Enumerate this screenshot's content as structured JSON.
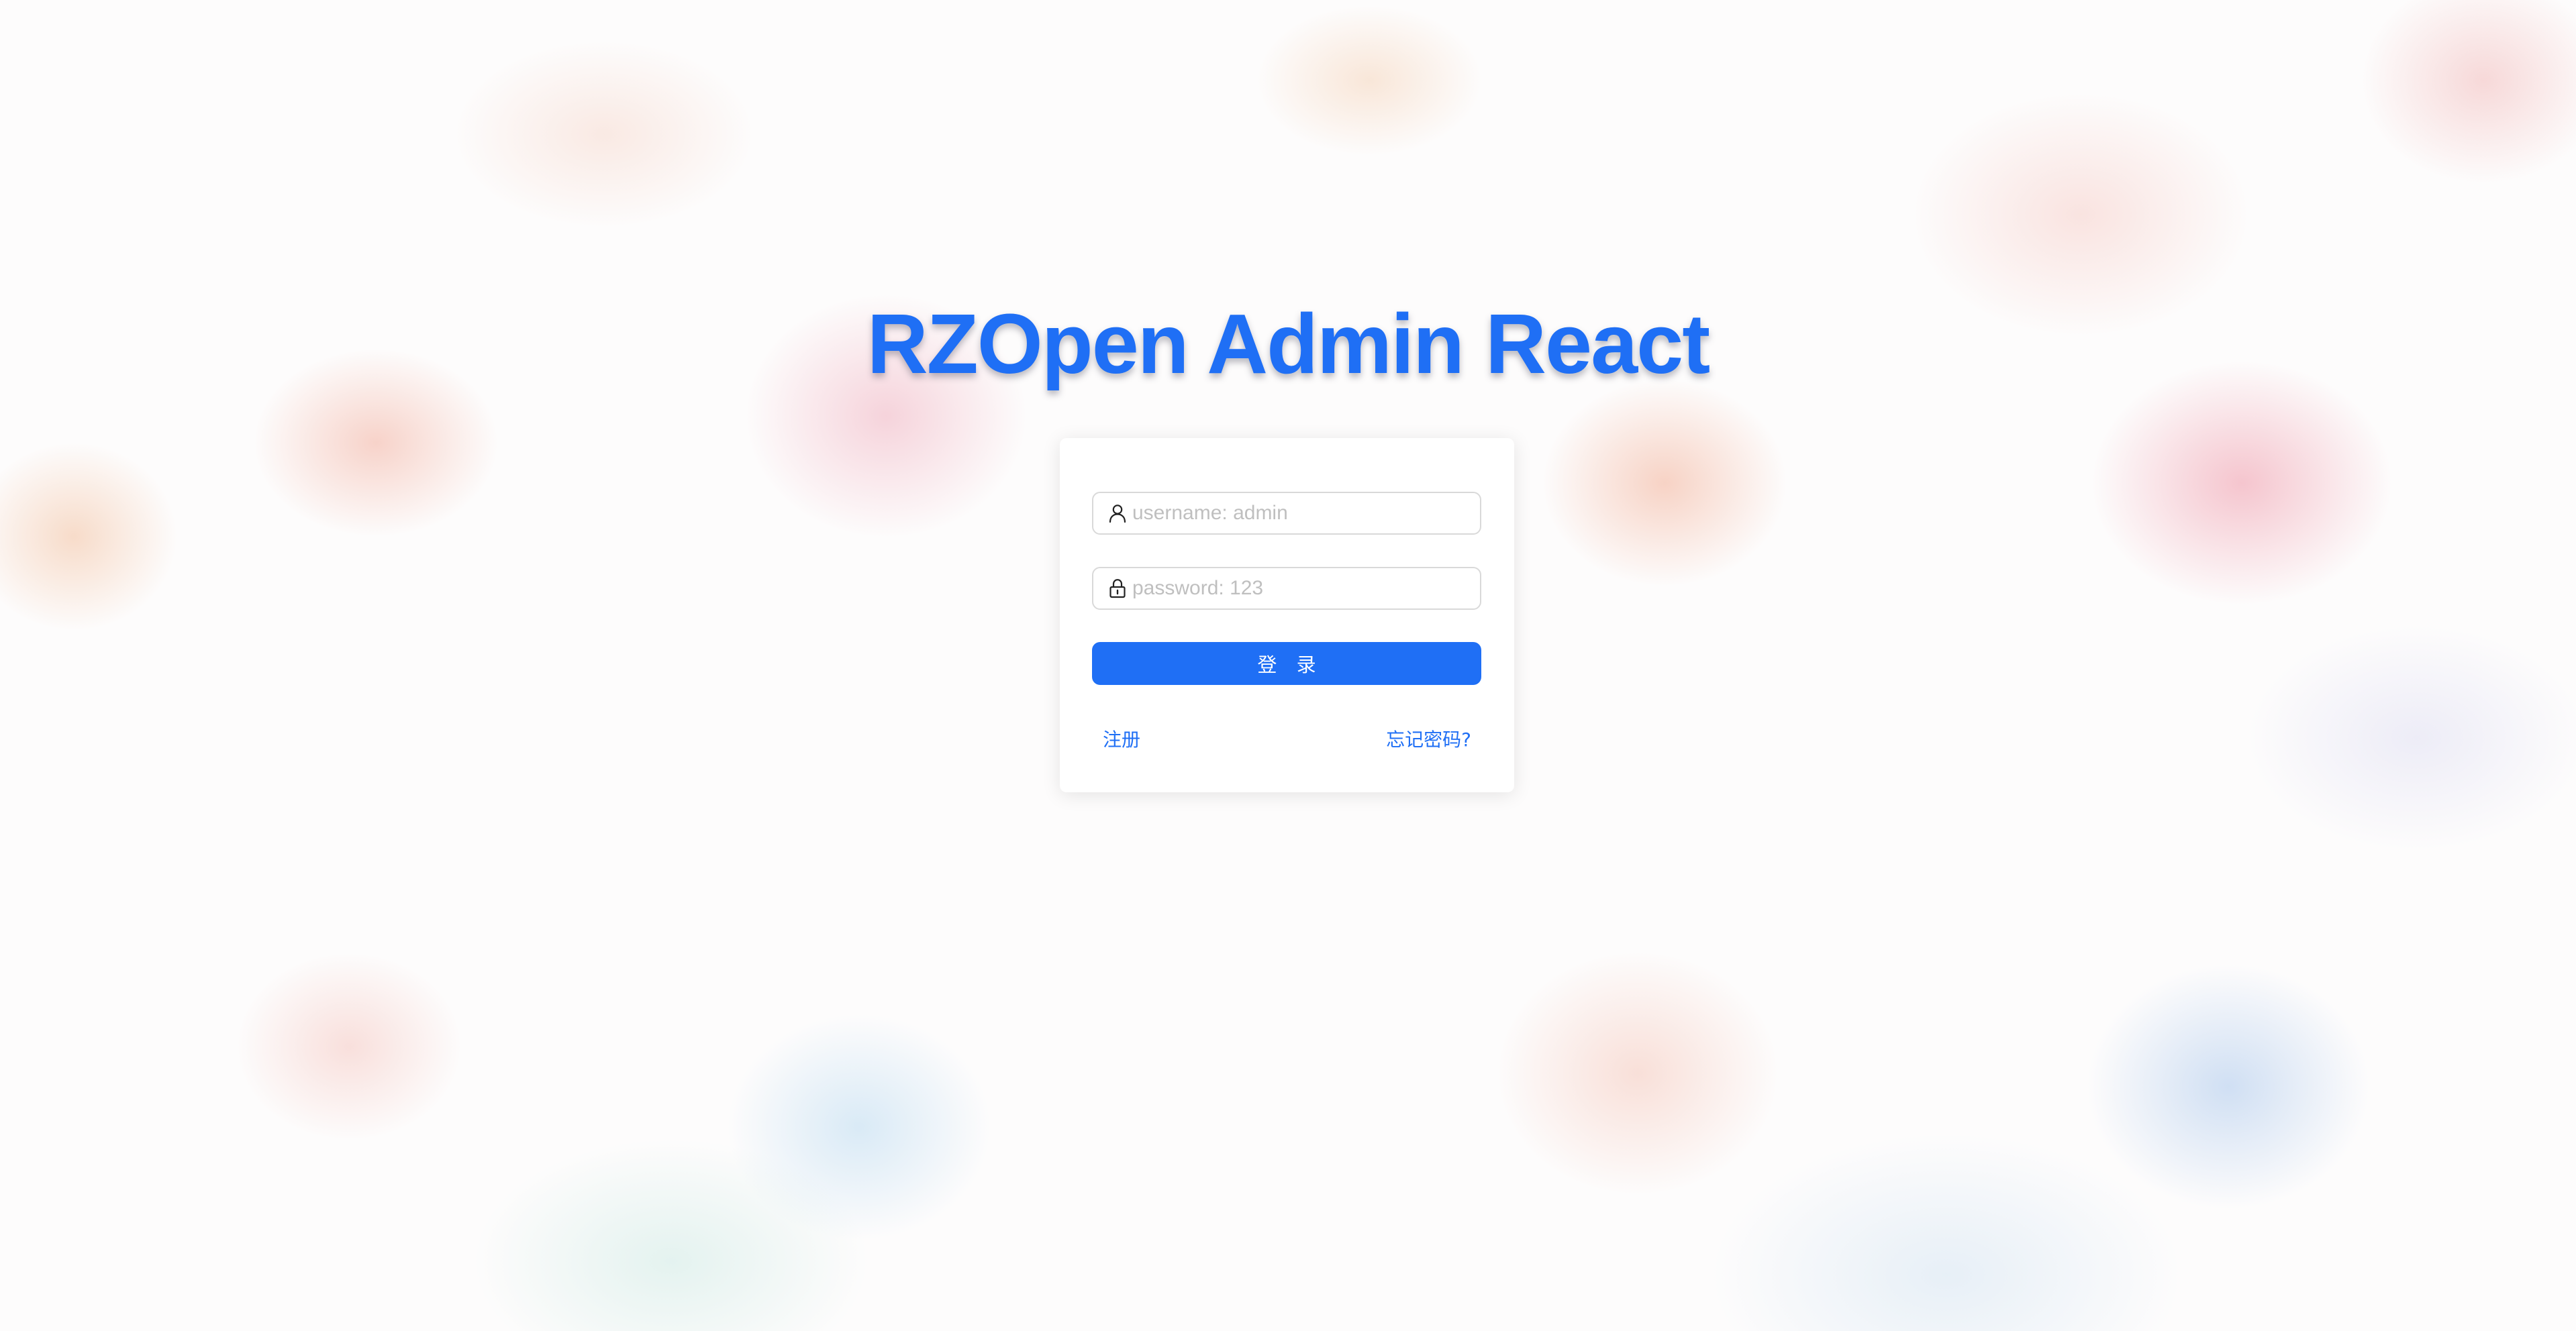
{
  "app": {
    "title": "RZOpen Admin React"
  },
  "login_form": {
    "username_placeholder": "username: admin",
    "username_value": "",
    "username_icon": "user-icon",
    "password_placeholder": "password: 123",
    "password_value": "",
    "password_icon": "lock-icon",
    "submit_label": "登 录",
    "register_label": "注册",
    "forgot_label": "忘记密码?"
  },
  "colors": {
    "accent": "#1f6ff5",
    "card_background": "#ffffff",
    "input_border": "#d9d9d9",
    "placeholder": "#bfbfbf"
  }
}
